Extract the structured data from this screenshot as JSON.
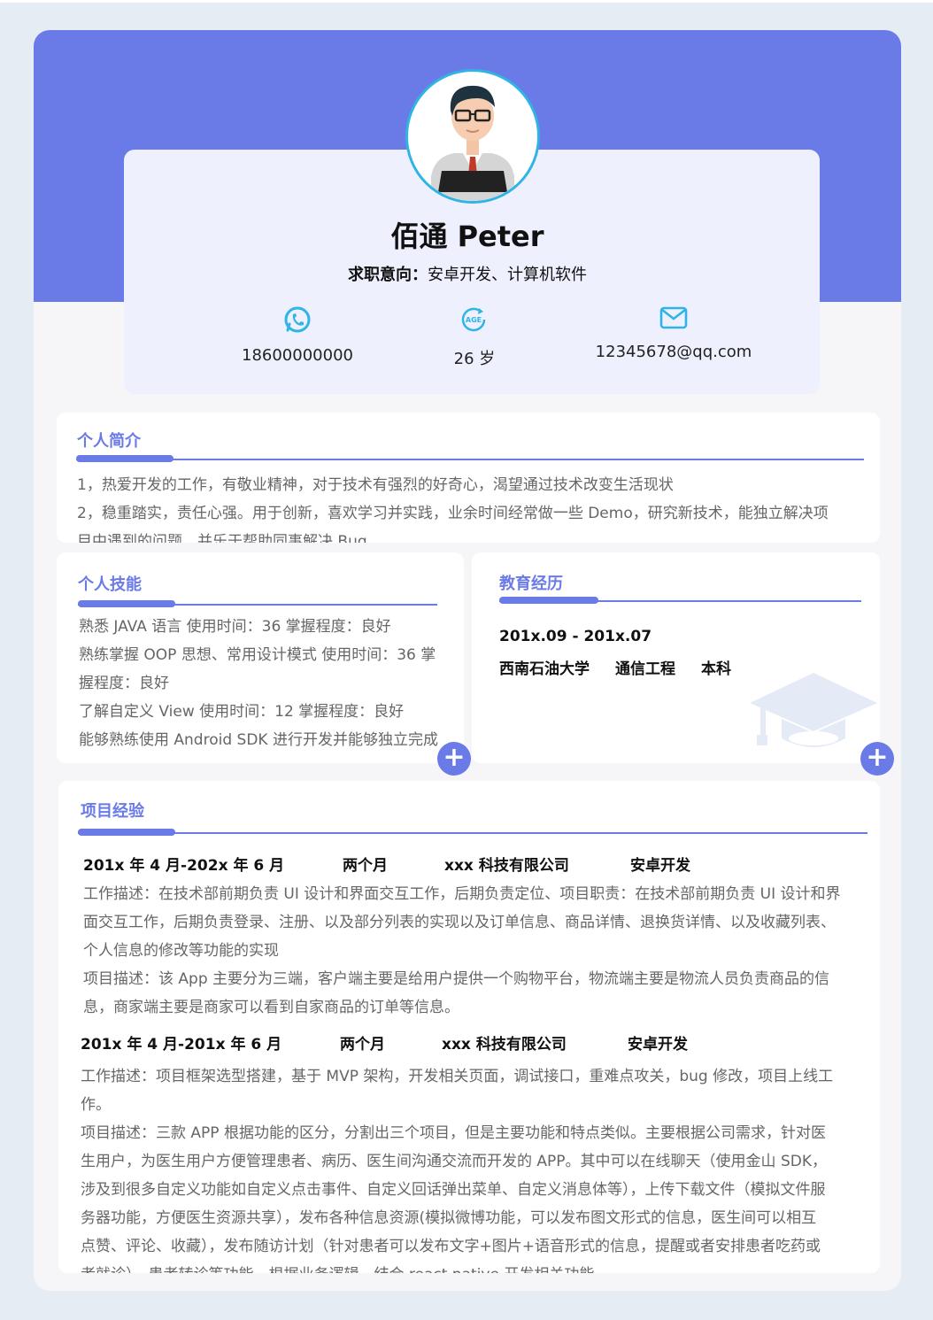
{
  "header": {
    "name": "佰通  Peter",
    "intent_label": "求职意向：",
    "intent_value": "安卓开发、计算机软件",
    "contacts": [
      {
        "icon": "whatsapp-icon",
        "value": "18600000000"
      },
      {
        "icon": "age-icon",
        "value": "26 岁"
      },
      {
        "icon": "mail-icon",
        "value": "12345678@qq.com"
      }
    ]
  },
  "profile": {
    "title": "个人简介",
    "lines": [
      "1，热爱开发的工作，有敬业精神，对于技术有强烈的好奇心，渴望通过技术改变生活现状",
      "2，稳重踏实，责任心强。用于创新，喜欢学习并实践，业余时间经常做一些 Demo，研究新技术，能独立解决项",
      "目中遇到的问题，并乐于帮助同事解决 Bug。"
    ]
  },
  "skills": {
    "title": "个人技能",
    "lines": [
      "熟悉 JAVA 语言  使用时间：36  掌握程度：良好",
      "熟练掌握 OOP 思想、常用设计模式  使用时间：36  掌",
      "握程度：良好",
      "了解自定义 View  使用时间：12  掌握程度：良好",
      "能够熟练使用 Android SDK 进行开发并能够独立完成"
    ]
  },
  "education": {
    "title": "教育经历",
    "period": "201x.09 - 201x.07",
    "school": "西南石油大学",
    "major": "通信工程",
    "degree": "本科"
  },
  "projects": {
    "title": "项目经验",
    "items": [
      {
        "period": "201x 年 4 月-202x 年 6 月",
        "duration": "两个月",
        "company": "xxx 科技有限公司",
        "role": "安卓开发",
        "lines": [
          "工作描述：在技术部前期负责 UI 设计和界面交互工作，后期负责定位、项目职责：在技术部前期负责 UI 设计和界",
          "面交互工作，后期负责登录、注册、以及部分列表的实现以及订单信息、商品详情、退换货详情、以及收藏列表、",
          "个人信息的修改等功能的实现",
          "项目描述：该 App 主要分为三端，客户端主要是给用户提供一个购物平台，物流端主要是物流人员负责商品的信",
          "息，商家端主要是商家可以看到自家商品的订单等信息。"
        ]
      },
      {
        "period": "201x 年 4 月-201x 年 6 月",
        "duration": "两个月",
        "company": "xxx 科技有限公司",
        "role": "安卓开发",
        "lines": [
          "工作描述：项目框架选型搭建，基于 MVP 架构，开发相关页面，调试接口，重难点攻关，bug 修改，项目上线工",
          "作。",
          "项目描述：三款 APP 根据功能的区分，分割出三个项目，但是主要功能和特点类似。主要根据公司需求，针对医",
          "生用户，为医生用户方便管理患者、病历、医生间沟通交流而开发的 APP。其中可以在线聊天（使用金山 SDK，",
          "涉及到很多自定义功能如自定义点击事件、自定义回话弹出菜单、自定义消息体等），上传下载文件（模拟文件服",
          "务器功能，方便医生资源共享），发布各种信息资源(模拟微博功能，可以发布图文形式的信息，医生间可以相互",
          "点赞、评论、收藏），发布随访计划（针对患者可以发布文字+图片+语音形式的信息，提醒或者安排患者吃药或",
          "者就诊），患者转诊等功能。根据业务逻辑，结合 react native 开发相关功能。"
        ]
      }
    ]
  },
  "actions": {
    "add_symbol": "+"
  },
  "colors": {
    "accent": "#6a7ae6",
    "avatar_border": "#2fb4e6",
    "icon": "#2fb4e6"
  }
}
